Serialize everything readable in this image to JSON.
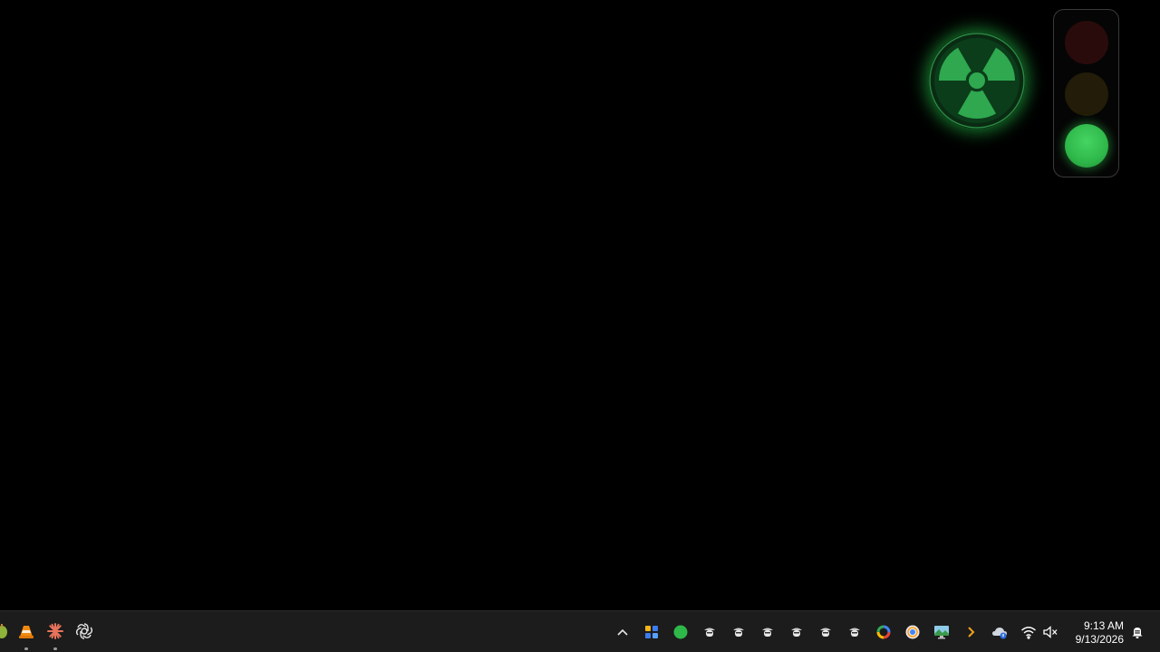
{
  "desktop": {
    "widgets": {
      "radiation": {
        "icon": "radiation-icon",
        "color": "#2fa84f"
      },
      "traffic_light": {
        "active_lamp": "green",
        "colors": {
          "red": "#2a0b0b",
          "yellow": "#231c08",
          "green": "#2fb84a"
        }
      }
    }
  },
  "taskbar": {
    "pinned": [
      {
        "icon": "partial-app-icon"
      },
      {
        "icon": "vlc-cone-icon",
        "running": true
      },
      {
        "icon": "sunburst-app-icon",
        "running": true
      },
      {
        "icon": "openai-icon",
        "running": false
      }
    ],
    "tray": {
      "overflow_icon": "chevron-up-icon",
      "icons": [
        "colorful-grid-icon",
        "green-circle-icon",
        "hat-character-icon",
        "hat-character-icon",
        "hat-character-icon",
        "hat-character-icon",
        "hat-character-icon",
        "hat-character-icon",
        "google-g-icon",
        "chrome-icon",
        "monitor-landscape-icon",
        "orange-chevron-icon",
        "onedrive-icon",
        "wifi-icon",
        "volume-muted-icon"
      ]
    },
    "clock": {
      "time": "9:13 AM",
      "date": "9/13/2026"
    },
    "notification_icon": "notification-bell-icon"
  }
}
